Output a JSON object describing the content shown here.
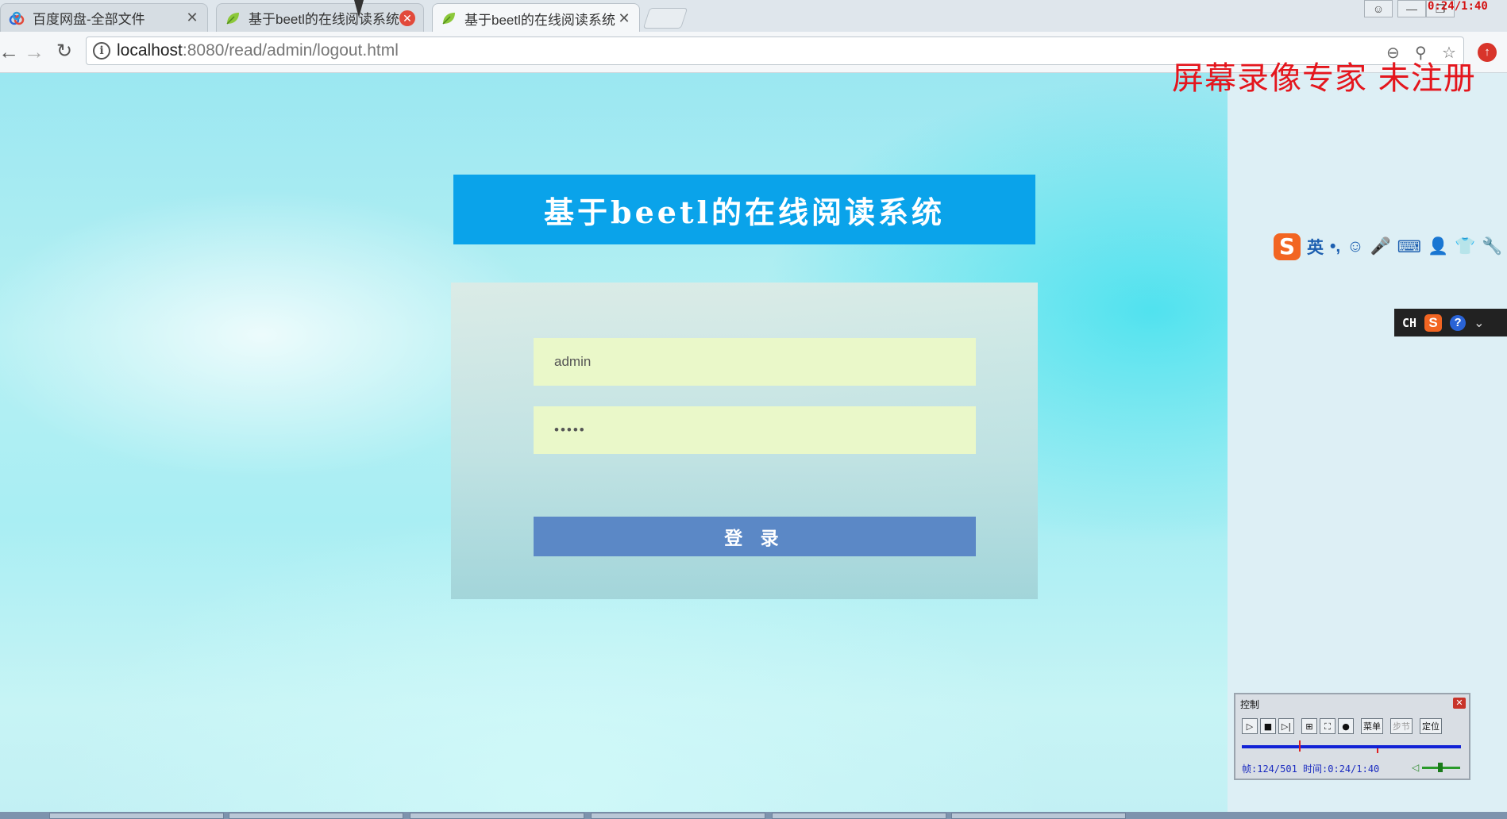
{
  "browser": {
    "tabs": [
      {
        "label": "百度网盘-全部文件",
        "icon": "baidu-cloud-icon",
        "close": "✕",
        "active": false
      },
      {
        "label": "基于beetl的在线阅读系统",
        "icon": "leaf-favicon-icon",
        "close": "✕",
        "active": false
      },
      {
        "label": "基于beetl的在线阅读系统",
        "icon": "leaf-favicon-icon",
        "close": "✕",
        "active": true
      }
    ],
    "url_host": "localhost",
    "url_path": ":8080/read/admin/logout.html",
    "recording_time": "0:24/1:40"
  },
  "watermark": "屏幕录像专家  未注册",
  "app": {
    "title": "基于beetl的在线阅读系统",
    "username_value": "admin",
    "password_mask": "•••••",
    "login_label": "登 录",
    "colors": {
      "title_bg": "#0aa3ea",
      "input_bg": "#eaf8c9",
      "button_bg": "#5b88c6"
    }
  },
  "ime": {
    "logo": "S",
    "mode": "英",
    "punct": "•,",
    "mini_label": "CH"
  },
  "recorder": {
    "title": "控制",
    "menu_label": "菜单",
    "step_label": "步节",
    "locate_label": "定位",
    "status": "帧:124/501 时间:0:24/1:40"
  }
}
